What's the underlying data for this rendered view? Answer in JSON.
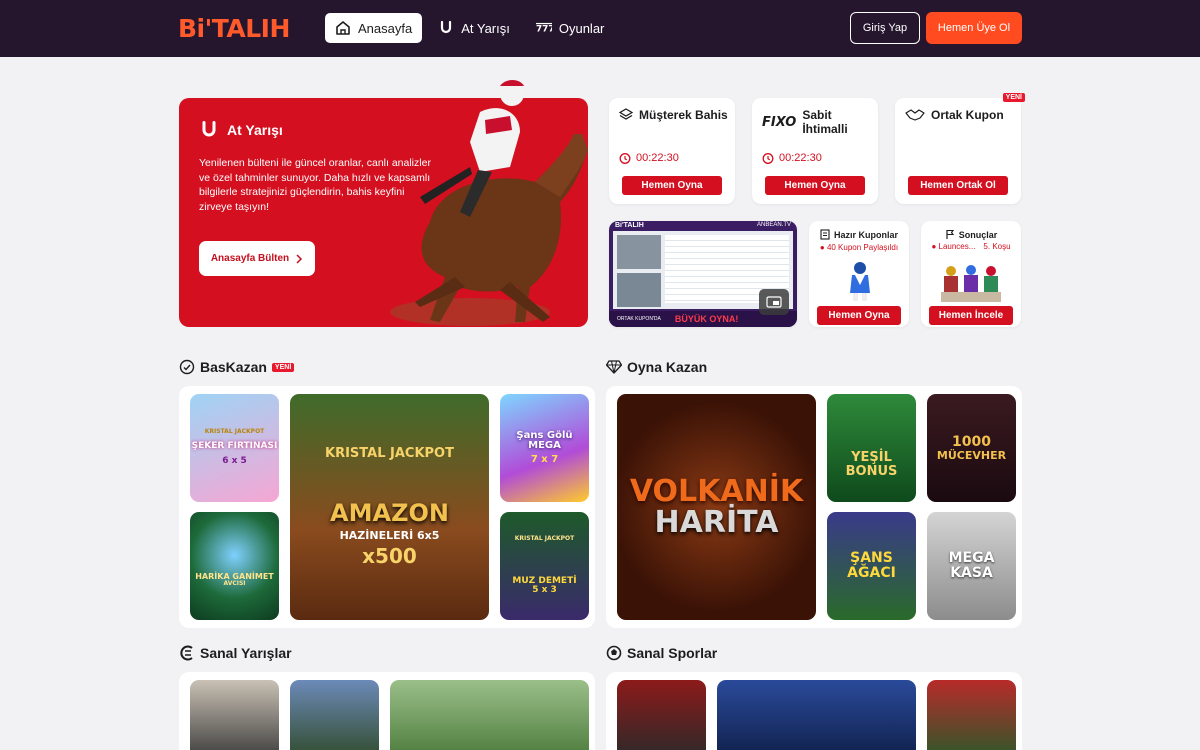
{
  "header": {
    "logo": "Bi'TALIH",
    "nav": [
      {
        "label": "Anasayfa",
        "icon": "home-icon",
        "active": true
      },
      {
        "label": "At Yarışı",
        "icon": "horseshoe-icon",
        "active": false
      },
      {
        "label": "Oyunlar",
        "icon": "slot-777-icon",
        "active": false
      }
    ],
    "login_label": "Giriş Yap",
    "signup_label": "Hemen Üye Ol"
  },
  "hero": {
    "title": "At Yarışı",
    "description": "Yenilenen bülteni ile güncel oranlar, canlı analizler ve özel tahminler sunuyor. Daha hızlı ve kapsamlı bilgilerle stratejinizi güçlendirin, bahis keyfini zirveye taşıyın!",
    "button_label": "Anasayfa Bülten"
  },
  "cards": {
    "musterek": {
      "title": "Müşterek Bahis",
      "timer": "00:22:30",
      "button": "Hemen Oyna"
    },
    "sabit": {
      "logo": "FIXO",
      "title": "Sabit İhtimalli",
      "timer": "00:22:30",
      "button": "Hemen Oyna"
    },
    "ortak": {
      "title": "Ortak Kupon",
      "badge": "YENİ",
      "button": "Hemen Ortak Ol"
    },
    "video": {
      "brand": "Bi'TALIH",
      "channel": "ANBEAN.TV",
      "caption": "ORTAK KUPON'DA",
      "caption2": "BÜYÜK OYNA!"
    },
    "hazir": {
      "title": "Hazır Kuponlar",
      "subtitle": "40 Kupon Paylaşıldı",
      "button": "Hemen Oyna"
    },
    "sonuclar": {
      "title": "Sonuçlar",
      "subtitle": "Launces...",
      "race": "5. Koşu",
      "button": "Hemen İncele"
    }
  },
  "sections": {
    "baskazan": {
      "title": "BasKazan",
      "badge": "YENİ"
    },
    "oyna_kazan": {
      "title": "Oyna Kazan"
    },
    "sanal_yarislar": {
      "title": "Sanal Yarışlar"
    },
    "sanal_sporlar": {
      "title": "Sanal Sporlar"
    }
  },
  "games_left": [
    {
      "top": "KRISTAL JACKPOT",
      "name": "ŞEKER FIRTINASI",
      "sub": "6 x 5"
    },
    {
      "top": "KRISTAL JACKPOT",
      "name": "AMAZON",
      "sub": "HAZİNELERİ 6x5",
      "extra": "x500"
    },
    {
      "top": "",
      "name": "Şans Gölü MEGA",
      "sub": "7 x 7"
    },
    {
      "top": "",
      "name": "HARİKA GANİMET",
      "sub": "AVCISI"
    },
    {
      "top": "KRISTAL JACKPOT",
      "name": "MUZ DEMETİ",
      "sub": "5 x 3"
    }
  ],
  "games_right": [
    {
      "name": "VOLKANİK",
      "sub": "HARİTA"
    },
    {
      "name": "YEŞİL",
      "sub": "BONUS"
    },
    {
      "name": "1000",
      "sub": "MÜCEVHER"
    },
    {
      "name": "ŞANS",
      "sub": "AĞACI"
    },
    {
      "name": "MEGA",
      "sub": "KASA"
    }
  ],
  "colors": {
    "header_bg": "#25162e",
    "brand_red": "#d40f1f",
    "accent_orange": "#ff4b1f",
    "page_bg": "#f2f2f4"
  }
}
